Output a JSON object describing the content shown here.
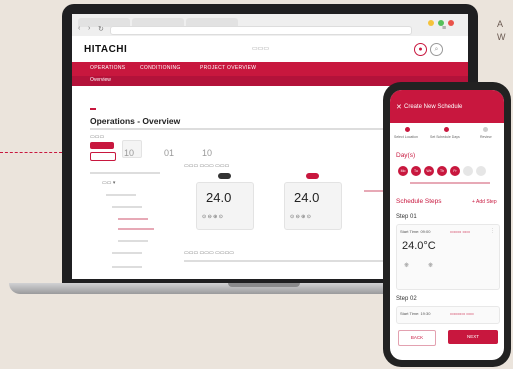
{
  "corner_text": "A\nW",
  "browser": {
    "tabs": [
      "",
      "",
      ""
    ]
  },
  "app": {
    "logo": "HITACHI",
    "nav": [
      "OPERATIONS",
      "CONDITIONING",
      "PROJECT OVERVIEW"
    ],
    "subnav": [
      "Overview"
    ],
    "page_title": "Operations - Overview",
    "device_temps": [
      "24.0",
      "24.0"
    ],
    "kpis": [
      "10",
      "01",
      "10"
    ]
  },
  "phone": {
    "title": "Create New Schedule",
    "steps": [
      "Select Location",
      "Set Schedule Days",
      "Review"
    ],
    "days_heading": "Day(s)",
    "days": [
      "Mo",
      "Tu",
      "We",
      "Th",
      "Fr",
      "Sa",
      "Su"
    ],
    "schedule_heading": "Schedule Steps",
    "add_step": "+ Add Step",
    "step1": "Step 01",
    "start_time_1": "Start Time: 09:00",
    "temp": "24.0°C",
    "step2": "Step 02",
    "start_time_2": "Start Time: 19:30",
    "back": "BACK",
    "next": "NEXT"
  },
  "colors": {
    "accent": "#c8173e",
    "background": "#ebe4dc"
  }
}
